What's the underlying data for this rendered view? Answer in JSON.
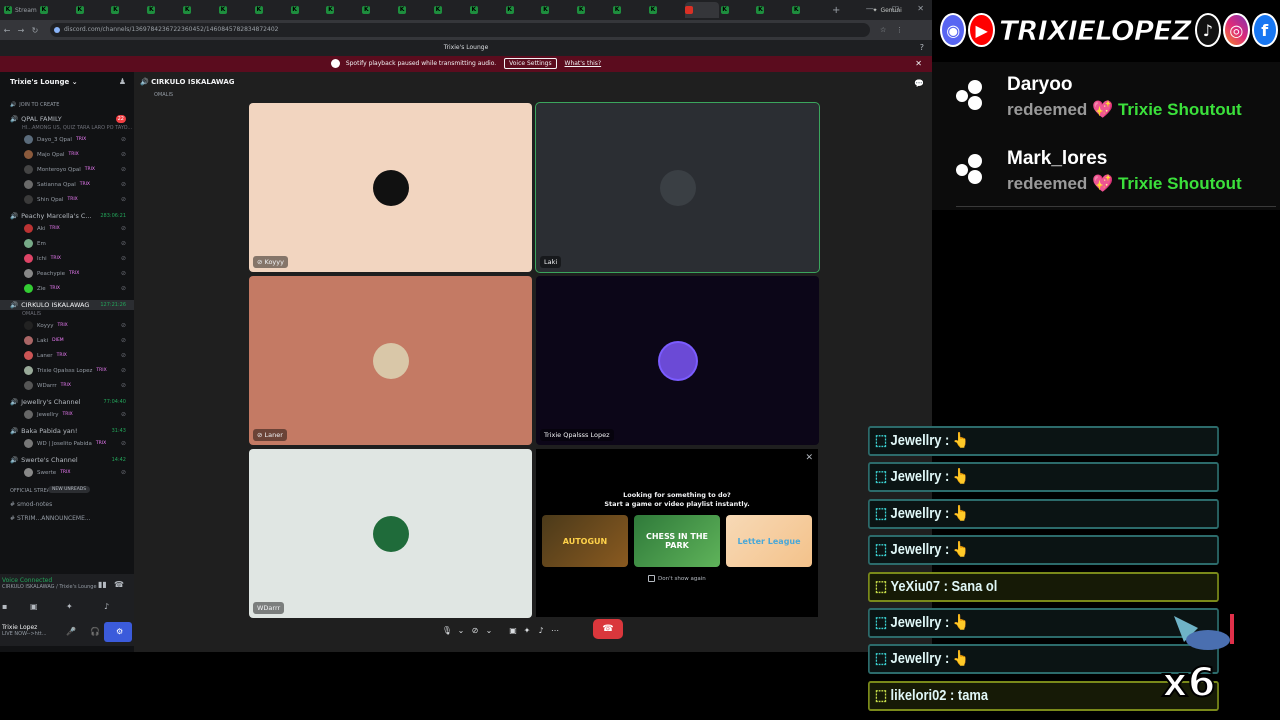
{
  "browser": {
    "tabs": [
      "Stream",
      "",
      "",
      "",
      "",
      "",
      "",
      "",
      "",
      "",
      "",
      "",
      "",
      "",
      "",
      "",
      "",
      "",
      "",
      "",
      "",
      "",
      ""
    ],
    "active_tab_index": 19,
    "gemini_tab": "Gemini",
    "url": "discord.com/channels/1369784236722360452/1460845782834872402"
  },
  "discord": {
    "window_title": "Trixie's Lounge",
    "notice": {
      "text": "Spotify playback paused while transmitting audio.",
      "button": "Voice Settings",
      "link": "What's this?"
    },
    "server_name": "Trixie's Lounge",
    "join_to_create": "JOIN TO CREATE",
    "channels": [
      {
        "name": "QPAL FAMILY",
        "badge": "22",
        "status": "HI...AMONG US, QUIZ TARA LARO PO TAYO...",
        "members": [
          {
            "name": "Dayo_3 Qpal",
            "tag": "TRIX"
          },
          {
            "name": "Majo Qpal",
            "tag": "TRIX"
          },
          {
            "name": "Monteroyo Qpal",
            "tag": "TRIX"
          },
          {
            "name": "Satianna Qpal",
            "tag": "TRIX"
          },
          {
            "name": "Shin Qpal",
            "tag": "TRIX"
          }
        ]
      },
      {
        "name": "Peachy Marcella's C...",
        "count": "283:06:21",
        "members": [
          {
            "name": "Aki",
            "tag": "TRIX"
          },
          {
            "name": "Em",
            "tag": ""
          },
          {
            "name": "Ichi",
            "tag": "TRIX"
          },
          {
            "name": "Peachypie",
            "tag": "TRIX"
          },
          {
            "name": "Zie",
            "tag": "TRIX"
          }
        ]
      },
      {
        "name": "CIRKULO ISKALAWAG",
        "count": "127:21:26",
        "status": "OMALIS",
        "members": [
          {
            "name": "Koyyy",
            "tag": "TRIX"
          },
          {
            "name": "Laki",
            "tag": "DIEM"
          },
          {
            "name": "Laner",
            "tag": "TRIX"
          },
          {
            "name": "Trixie Qpalsss Lopez",
            "tag": "TRIX"
          },
          {
            "name": "WDarrr",
            "tag": "TRIX"
          }
        ]
      },
      {
        "name": "Jewellry's Channel",
        "count": "77:04:40",
        "members": [
          {
            "name": "Jewellry",
            "tag": "TRIX"
          }
        ]
      },
      {
        "name": "Baka Pabida yan!",
        "count": "31:43",
        "members": [
          {
            "name": "WD | Joselito Pabida",
            "tag": "TRIX"
          }
        ]
      },
      {
        "name": "Swerte's Channel",
        "count": "14:42",
        "members": [
          {
            "name": "Swerte",
            "tag": "TRIX"
          }
        ]
      }
    ],
    "official_stream": "OFFICIAL STREA...",
    "text_channels": [
      "smod-notes",
      "STRIM...ANNOUNCEME..."
    ],
    "new_unreads": "NEW UNREADS",
    "voice_connected": "Voice Connected",
    "voice_location": "CIRKULO ISKALAWAG / Trixie's Lounge",
    "user_name": "Trixie Lopez",
    "user_status": "LIVE NOW-->htt...",
    "voice_header": "CIRKULO ISKALAWAG",
    "voice_sub": "OMALIS",
    "tiles": [
      {
        "name": "Koyyy",
        "bg": "#f2d5c0",
        "muted": true
      },
      {
        "name": "Laki",
        "bg": "#2b2e33",
        "muted": false
      },
      {
        "name": "Laner",
        "bg": "#c47a64",
        "muted": true
      },
      {
        "name": "Trixie Qpalsss Lopez",
        "bg": "#0c0618",
        "muted": false
      },
      {
        "name": "WDarrr",
        "bg": "#e0e6e3",
        "muted": false
      }
    ],
    "activity": {
      "title_line1": "Looking for something to do?",
      "title_line2": "Start a game or video playlist instantly.",
      "cards": [
        "AUTOGUN",
        "CHESS IN THE PARK",
        "Letter League"
      ],
      "dont_show": "Don't show again"
    }
  },
  "overlay": {
    "handle": "TRIXIELOPEZ",
    "alerts": [
      {
        "user": "Daryoo",
        "action": "redeemed",
        "reward": "Trixie Shoutout"
      },
      {
        "user": "Mark_lores",
        "action": "redeemed",
        "reward": "Trixie Shoutout"
      }
    ],
    "chat": [
      {
        "text": "Jewellry : 👆",
        "style": "teal"
      },
      {
        "text": "Jewellry : 👆",
        "style": "teal"
      },
      {
        "text": "Jewellry : 👆",
        "style": "teal"
      },
      {
        "text": "Jewellry : 👆",
        "style": "teal"
      },
      {
        "text": "YeXiu07 : Sana ol",
        "style": "gold"
      },
      {
        "text": "Jewellry : 👆",
        "style": "teal"
      },
      {
        "text": "Jewellry : 👆",
        "style": "teal"
      },
      {
        "text": "likelori02 : tama",
        "style": "gold"
      }
    ],
    "multiplier": "x6"
  }
}
